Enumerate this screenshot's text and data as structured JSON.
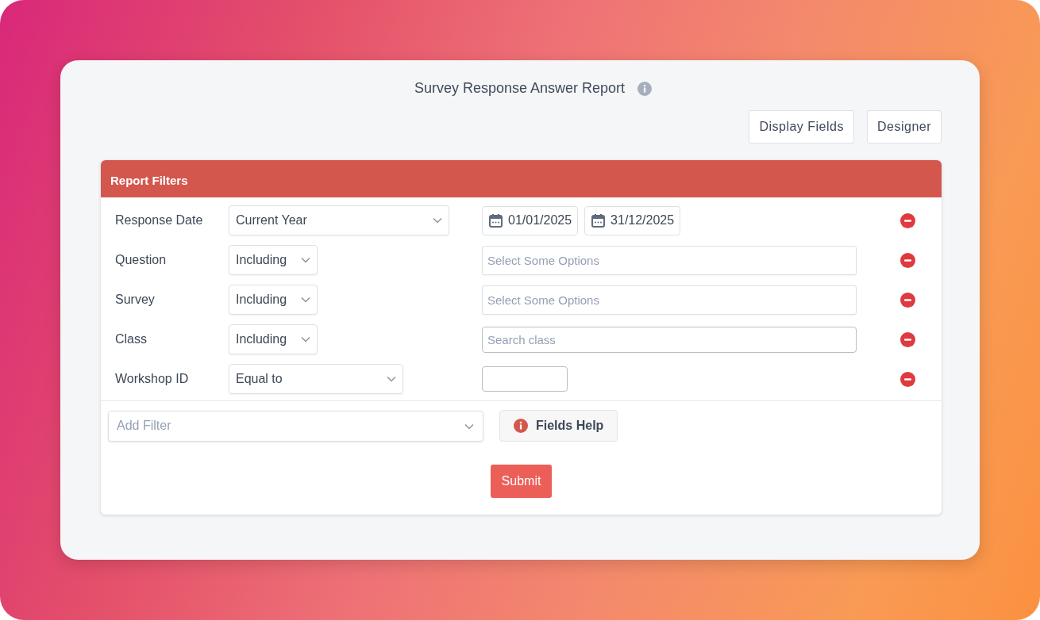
{
  "report": {
    "title": "Survey Response Answer Report"
  },
  "toolbar": {
    "buttons": [
      "Display Fields",
      "Designer"
    ]
  },
  "filters_panel": {
    "title": "Report Filters",
    "filters": [
      {
        "kind": "date",
        "label": "Response Date",
        "operator": "Current Year",
        "start_date": "01/01/2025",
        "end_date": "31/12/2025"
      },
      {
        "kind": "multiselect",
        "label": "Question",
        "operator": "Including",
        "placeholder": "Select Some Options"
      },
      {
        "kind": "multiselect",
        "label": "Survey",
        "operator": "Including",
        "placeholder": "Select Some Options"
      },
      {
        "kind": "search",
        "label": "Class",
        "operator": "Including",
        "placeholder": "Search class"
      },
      {
        "kind": "number",
        "label": "Workshop ID",
        "operator": "Equal to"
      }
    ],
    "add_filter": {
      "placeholder": "Add Filter"
    },
    "help_button": "Fields Help",
    "submit_button": "Submit"
  }
}
